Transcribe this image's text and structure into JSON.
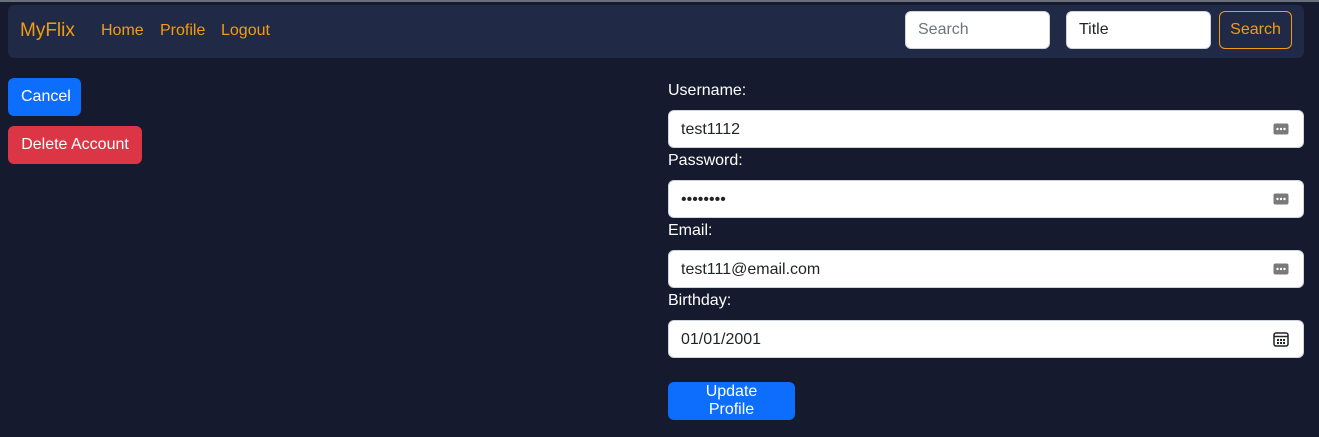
{
  "navbar": {
    "brand": "MyFlix",
    "links": {
      "home": "Home",
      "profile": "Profile",
      "logout": "Logout"
    },
    "search_placeholder": "Search",
    "title_value": "Title",
    "search_button": "Search"
  },
  "actions": {
    "cancel": "Cancel",
    "delete_account": "Delete Account"
  },
  "form": {
    "username": {
      "label": "Username:",
      "value": "test1112",
      "icon": "autofill-icon"
    },
    "password": {
      "label": "Password:",
      "value": "••••••••",
      "icon": "autofill-icon"
    },
    "email": {
      "label": "Email:",
      "value": "test111@email.com",
      "icon": "autofill-icon"
    },
    "birthday": {
      "label": "Birthday:",
      "value": "01/01/2001",
      "icon": "calendar-icon"
    },
    "submit": "Update Profile"
  },
  "colors": {
    "background": "#151a2e",
    "navbar": "#202a47",
    "accent": "#f39c12",
    "primary": "#0d6efd",
    "danger": "#dc3545"
  }
}
